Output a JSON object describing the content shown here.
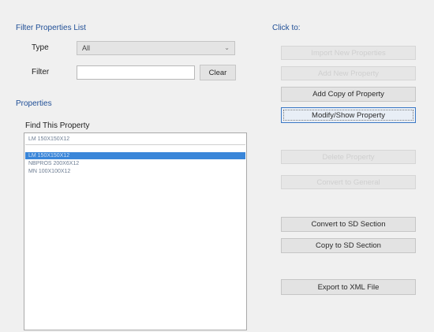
{
  "filter_group": {
    "title": "Filter Properties List",
    "type_label": "Type",
    "type_value": "All",
    "filter_label": "Filter",
    "filter_value": "",
    "clear_label": "Clear"
  },
  "properties_group": {
    "title": "Properties",
    "find_label": "Find This Property",
    "search_value": "LM 150X150X12",
    "items": [
      {
        "text": "LM 150X150X12",
        "selected": true
      },
      {
        "text": "NBPROS 200X6X12",
        "selected": false
      },
      {
        "text": "MN 100X100X12",
        "selected": false
      }
    ]
  },
  "click_to": {
    "title": "Click to:",
    "buttons": [
      {
        "label": "Import New Properties",
        "enabled": false
      },
      {
        "label": "Add New Property",
        "enabled": false
      },
      {
        "label": "Add Copy of Property",
        "enabled": true
      },
      {
        "label": "Modify/Show Property",
        "enabled": true,
        "focused": true
      },
      {
        "label": "Delete Property",
        "enabled": false
      },
      {
        "label": "Convert to General",
        "enabled": false
      },
      {
        "label": "Convert to SD Section",
        "enabled": true
      },
      {
        "label": "Copy to SD Section",
        "enabled": true
      },
      {
        "label": "Export to XML File",
        "enabled": true
      }
    ]
  }
}
